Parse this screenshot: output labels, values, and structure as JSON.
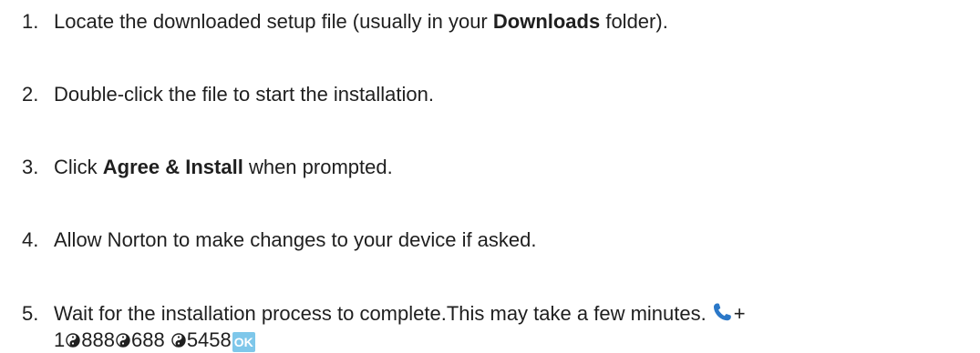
{
  "steps": [
    {
      "number": "1.",
      "pre": "Locate the downloaded setup file (usually in your ",
      "bold": "Downloads",
      "post": " folder)."
    },
    {
      "number": "2.",
      "text": "Double-click the file to start the installation."
    },
    {
      "number": "3.",
      "pre": "Click ",
      "bold": "Agree & Install",
      "post": " when prompted."
    },
    {
      "number": "4.",
      "text": "Allow Norton to make changes to your device if asked."
    },
    {
      "number": "5.",
      "text": "Wait for the installation process to complete.This may take a few minutes.",
      "phone": {
        "icon": "phone-icon",
        "plus": "+",
        "part1": "1",
        "part2": "888",
        "part3": "688",
        "part4": "5458",
        "separator_icon": "yin-yang-icon",
        "ok_badge": "OK",
        "ok_color": "#7ec7ea"
      }
    }
  ]
}
